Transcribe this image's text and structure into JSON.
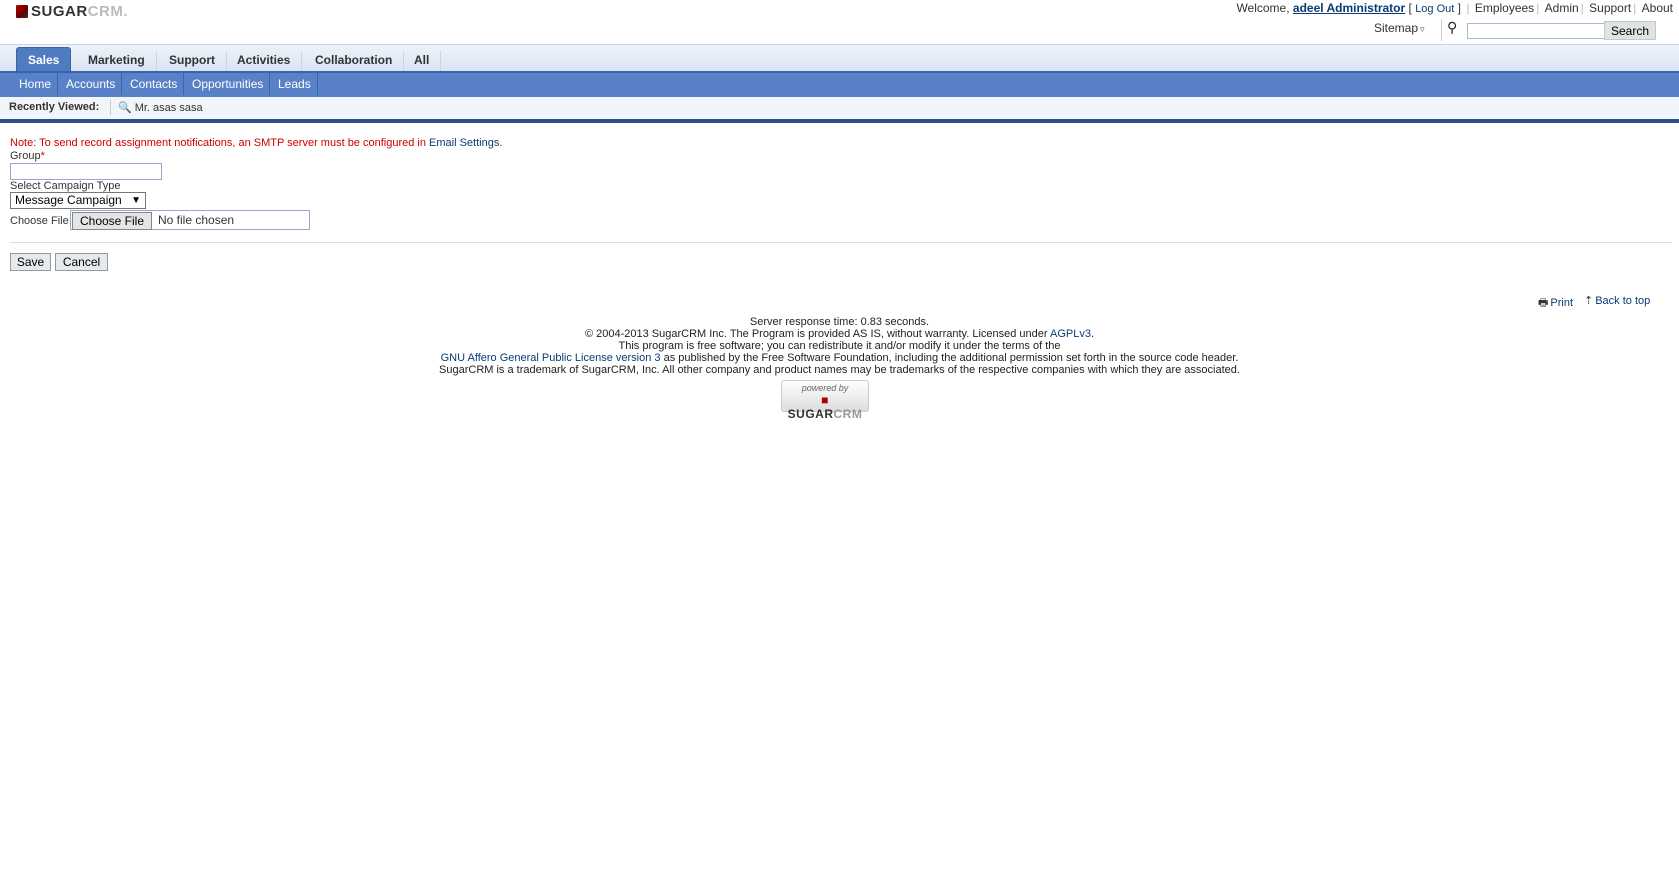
{
  "header": {
    "logo": {
      "brand_main": "SUGAR",
      "brand_accent": "CRM."
    },
    "welcome_prefix": "Welcome,",
    "user_name": "adeel Administrator",
    "logout_label": "Log Out",
    "top_links": [
      "Employees",
      "Admin",
      "Support",
      "About"
    ],
    "sitemap_label": "Sitemap",
    "search": {
      "value": "",
      "button_label": "Search"
    }
  },
  "module_tabs": [
    {
      "label": "Sales",
      "active": true
    },
    {
      "label": "Marketing"
    },
    {
      "label": "Support"
    },
    {
      "label": "Activities"
    },
    {
      "label": "Collaboration"
    },
    {
      "label": "All"
    }
  ],
  "sub_tabs": [
    "Home",
    "Accounts",
    "Contacts",
    "Opportunities",
    "Leads"
  ],
  "recently_viewed": {
    "label": "Recently Viewed:",
    "items": [
      "Mr. asas sasa"
    ]
  },
  "form": {
    "note_text": "Note: To send record assignment notifications, an SMTP server must be configured in ",
    "note_link": "Email Settings",
    "note_end": ".",
    "group_label": "Group",
    "required_marker": "*",
    "group_value": "",
    "campaign_type_label": "Select Campaign Type",
    "campaign_type_value": "Message Campaign",
    "choose_file_label": "Choose File",
    "choose_file_button": "Choose File",
    "no_file_text": "No file chosen",
    "save_label": "Save",
    "cancel_label": "Cancel"
  },
  "page_links": {
    "print": "Print",
    "back_to_top": "Back to top"
  },
  "footer": {
    "response_time": "Server response time: 0.83 seconds.",
    "copyright": "© 2004-2013 SugarCRM Inc. The Program is provided AS IS, without warranty. Licensed under ",
    "agpl_link": "AGPLv3",
    "copyright_end": ".",
    "free_software": "This program is free software; you can redistribute it and/or modify it under the terms of the",
    "gnu_link": "GNU Affero General Public License version 3",
    "gnu_rest": " as published by the Free Software Foundation, including the additional permission set forth in the source code header.",
    "trademark": "SugarCRM is a trademark of SugarCRM, Inc. All other company and product names may be trademarks of the respective companies with which they are associated.",
    "powered_by": "powered by",
    "powered_brand_main": "SUGAR",
    "powered_brand_accent": "CRM"
  }
}
